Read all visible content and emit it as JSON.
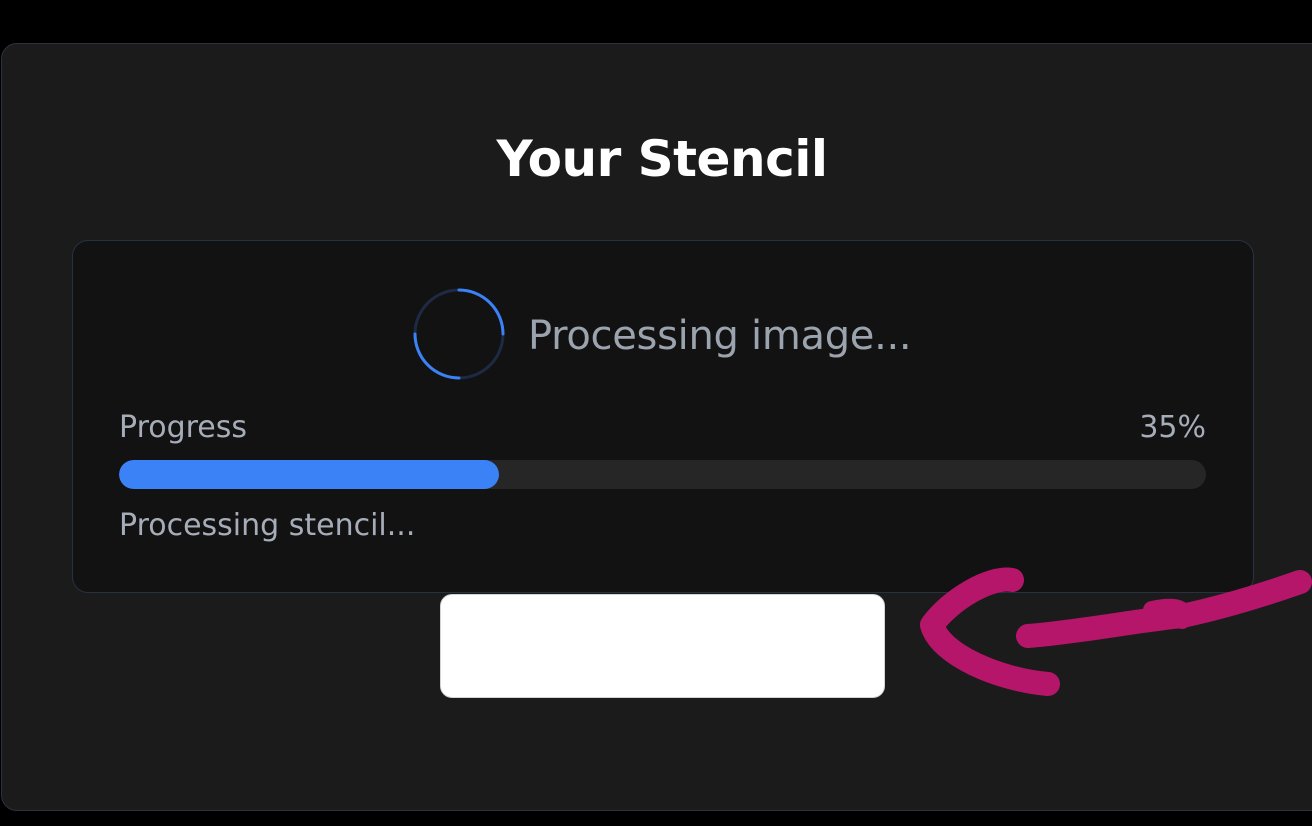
{
  "card": {
    "title": "Your Stencil"
  },
  "status_panel": {
    "spinner_icon": "loading-spinner-icon",
    "processing_message": "Processing image...",
    "progress_label": "Progress",
    "progress_value_text": "35%",
    "progress_fraction": 0.35,
    "status_message": "Processing stencil..."
  },
  "colors": {
    "accent": "#3b82f6",
    "annotation": "#b5166a",
    "background": "#000000",
    "card": "#1b1b1b",
    "panel": "#121212"
  },
  "annotation": {
    "icon": "hand-drawn-arrow-icon"
  }
}
